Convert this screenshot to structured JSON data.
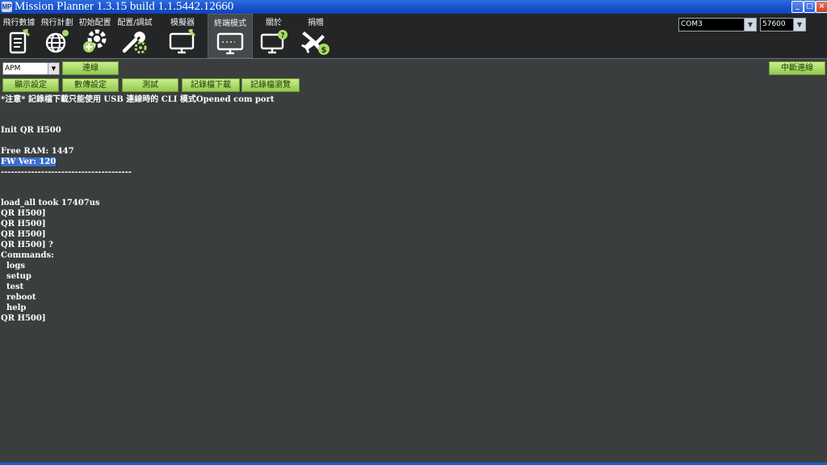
{
  "window": {
    "title": "Mission Planner 1.3.15 build 1.1.5442.12660",
    "icon": "MP",
    "controls": {
      "minimize": "_",
      "maximize": "□",
      "close": "×"
    }
  },
  "menu": {
    "items": [
      {
        "label": "飛行數據",
        "icon": "flight-data-icon"
      },
      {
        "label": "飛行計劃",
        "icon": "flight-plan-globe-icon"
      },
      {
        "label": "初始配置",
        "icon": "initial-setup-gear-icon"
      },
      {
        "label": "配置/調試",
        "icon": "config-tuning-wrench-icon"
      },
      {
        "label": "模擬器",
        "icon": "simulator-monitor-icon"
      },
      {
        "label": "終端模式",
        "icon": "terminal-monitor-icon",
        "active": true
      },
      {
        "label": "關於",
        "icon": "help-monitor-icon"
      },
      {
        "label": "捐贈",
        "icon": "donate-plane-icon"
      }
    ],
    "port": "COM3",
    "baud": "57600"
  },
  "toolbar": {
    "board_select": "APM",
    "connect": "連線",
    "disconnect": "中斷連線",
    "buttons": [
      "顯示設定",
      "數傳設定",
      "測試",
      "記錄檔下載",
      "記錄檔瀏覽"
    ]
  },
  "terminal": {
    "lines": [
      "*注意* 記錄檔下載只能使用 USB 連線時的 CLI 模式Opened com port",
      "",
      "",
      "Init QR H500",
      "",
      "Free RAM: 1447",
      "FW Ver: 120",
      "---------------------------------------",
      "",
      "",
      "load_all took 17407us",
      "QR H500]",
      "QR H500]",
      "QR H500]",
      "QR H500] ?",
      "Commands:",
      "  logs",
      "  setup",
      "  test",
      "  reboot",
      "  help",
      "QR H500]"
    ]
  },
  "colors": {
    "background": "#3b3e3f",
    "menubar": "#232527",
    "accent_green": "#a8dc64",
    "titlebar": "#1750c8",
    "selection": "#3a6fd0"
  }
}
